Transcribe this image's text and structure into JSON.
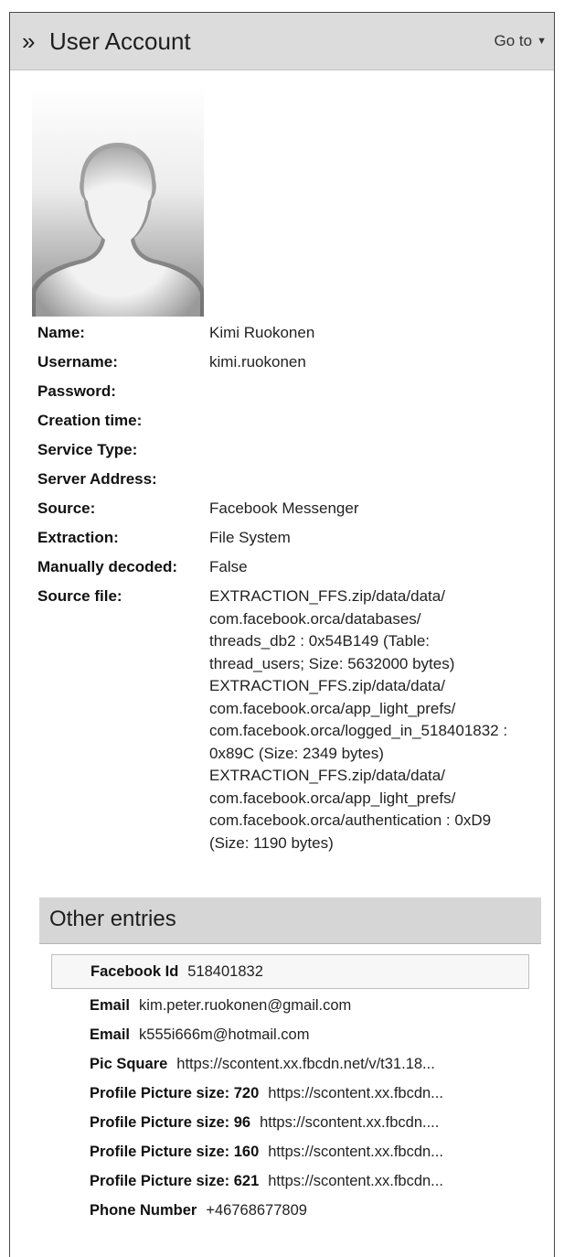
{
  "header": {
    "title": "User Account",
    "icon": "double-chevron-right-icon",
    "goto_label": "Go to"
  },
  "avatar": {
    "icon": "default-user-silhouette"
  },
  "fields": [
    {
      "label": "Name:",
      "value": "Kimi Ruokonen"
    },
    {
      "label": "Username:",
      "value": "kimi.ruokonen"
    },
    {
      "label": "Password:",
      "value": ""
    },
    {
      "label": "Creation time:",
      "value": ""
    },
    {
      "label": "Service Type:",
      "value": ""
    },
    {
      "label": "Server Address:",
      "value": ""
    },
    {
      "label": "Source:",
      "value": "Facebook Messenger"
    },
    {
      "label": "Extraction:",
      "value": "File System"
    },
    {
      "label": "Manually decoded:",
      "value": "False"
    },
    {
      "label": "Source file:",
      "value": ""
    }
  ],
  "source_file_lines": [
    "EXTRACTION_FFS.zip/data/data/",
    "com.facebook.orca/databases/",
    "threads_db2 : 0x54B149 (Table:",
    "thread_users; Size: 5632000 bytes)",
    "EXTRACTION_FFS.zip/data/data/",
    "com.facebook.orca/app_light_prefs/",
    "com.facebook.orca/logged_in_518401832 :",
    "0x89C (Size: 2349 bytes)",
    "EXTRACTION_FFS.zip/data/data/",
    "com.facebook.orca/app_light_prefs/",
    "com.facebook.orca/authentication : 0xD9",
    "(Size: 1190 bytes)"
  ],
  "other_entries": {
    "title": "Other entries",
    "items": [
      {
        "key": "Facebook Id",
        "value": "518401832"
      },
      {
        "key": "Email",
        "value": "kim.peter.ruokonen@gmail.com"
      },
      {
        "key": "Email",
        "value": "k555i666m@hotmail.com"
      },
      {
        "key": "Pic Square",
        "value": "https://scontent.xx.fbcdn.net/v/t31.18..."
      },
      {
        "key": "Profile Picture size: 720",
        "value": "https://scontent.xx.fbcdn..."
      },
      {
        "key": "Profile Picture size: 96",
        "value": "https://scontent.xx.fbcdn...."
      },
      {
        "key": "Profile Picture size: 160",
        "value": "https://scontent.xx.fbcdn..."
      },
      {
        "key": "Profile Picture size: 621",
        "value": "https://scontent.xx.fbcdn..."
      },
      {
        "key": "Phone Number",
        "value": "+46768677809"
      }
    ]
  }
}
